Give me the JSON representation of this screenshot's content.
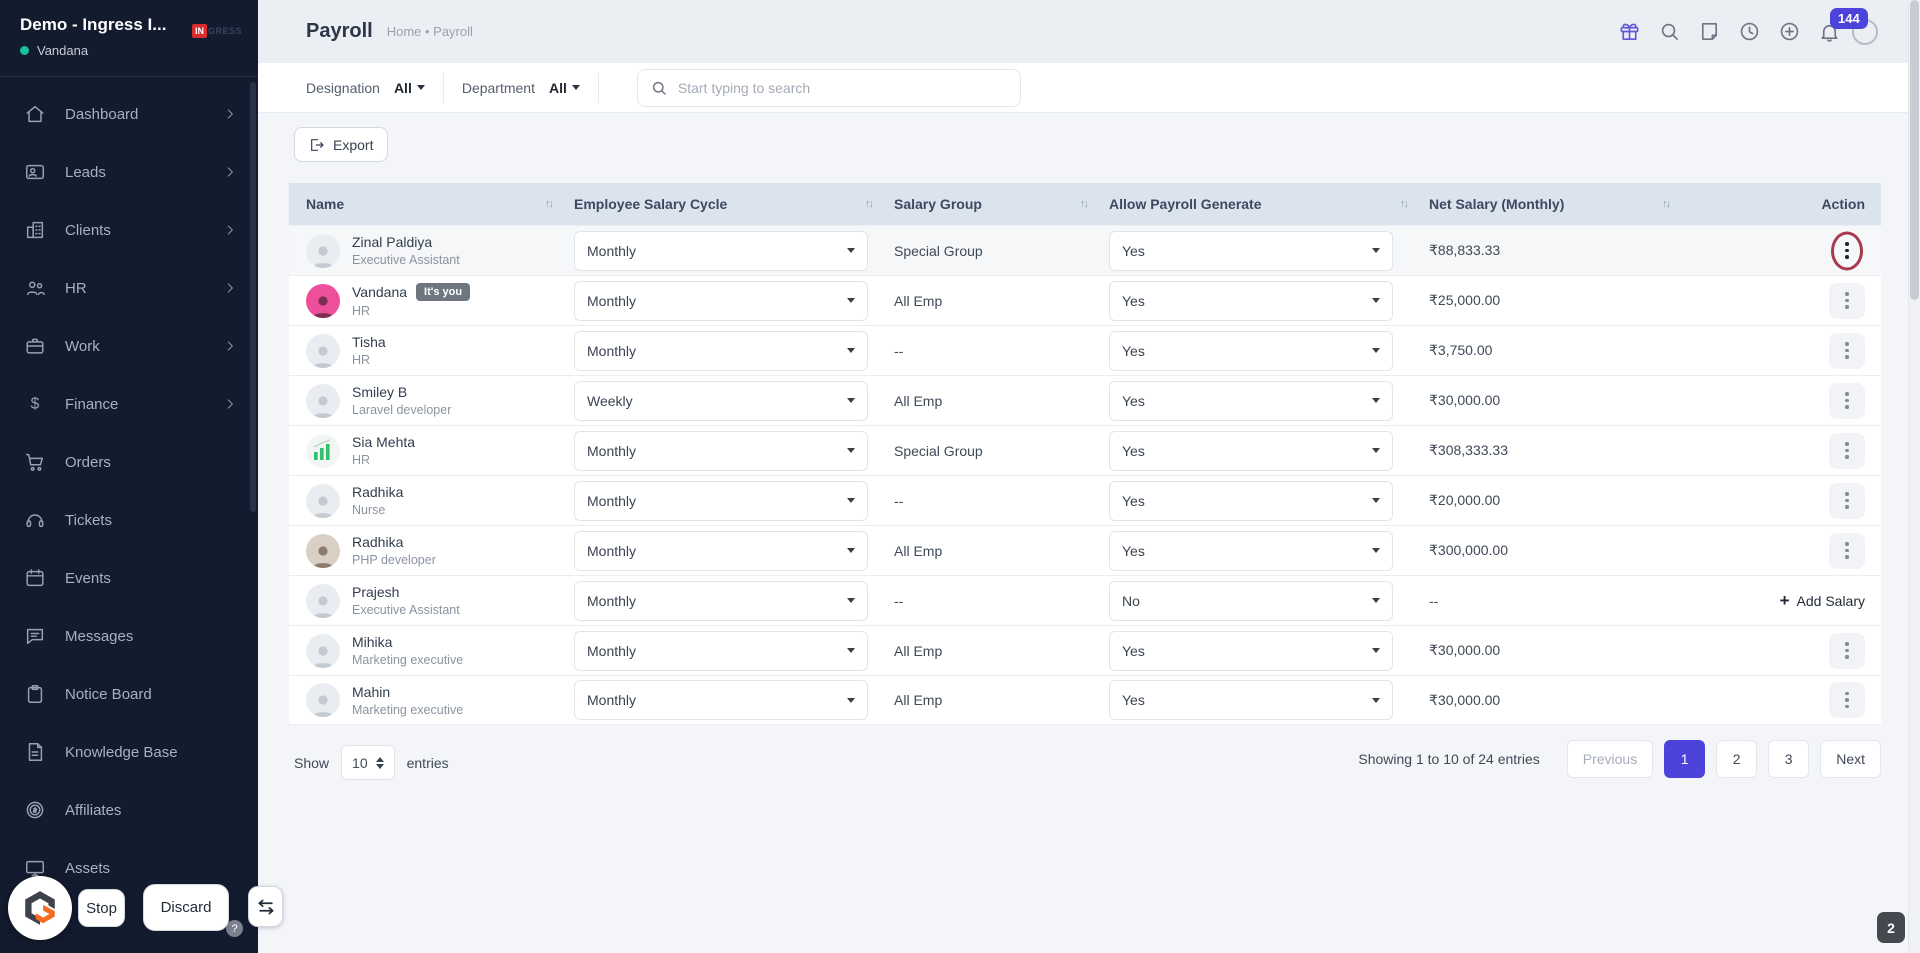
{
  "sidebar": {
    "workspace": "Demo - Ingress I...",
    "user": "Vandana",
    "logo_badge": "IN",
    "logo_rest": "GRESS",
    "items": [
      {
        "label": "Dashboard",
        "icon": "home-icon",
        "chevron": true
      },
      {
        "label": "Leads",
        "icon": "leads-icon",
        "chevron": true
      },
      {
        "label": "Clients",
        "icon": "building-icon",
        "chevron": true
      },
      {
        "label": "HR",
        "icon": "people-icon",
        "chevron": true
      },
      {
        "label": "Work",
        "icon": "briefcase-icon",
        "chevron": true
      },
      {
        "label": "Finance",
        "icon": "dollar-icon",
        "chevron": true
      },
      {
        "label": "Orders",
        "icon": "cart-icon",
        "chevron": false
      },
      {
        "label": "Tickets",
        "icon": "headset-icon",
        "chevron": false
      },
      {
        "label": "Events",
        "icon": "calendar-icon",
        "chevron": false
      },
      {
        "label": "Messages",
        "icon": "chat-icon",
        "chevron": false
      },
      {
        "label": "Notice Board",
        "icon": "clipboard-icon",
        "chevron": false
      },
      {
        "label": "Knowledge Base",
        "icon": "document-icon",
        "chevron": false
      },
      {
        "label": "Affiliates",
        "icon": "coin-icon",
        "chevron": false
      },
      {
        "label": "Assets",
        "icon": "monitor-icon",
        "chevron": false
      }
    ]
  },
  "header": {
    "title": "Payroll",
    "breadcrumb": "Home • Payroll",
    "notification_count": "144",
    "icons": [
      "gift-icon",
      "search-icon",
      "note-icon",
      "clock-icon",
      "plus-circle-icon",
      "bell-icon"
    ]
  },
  "filters": {
    "designation_label": "Designation",
    "designation_value": "All",
    "department_label": "Department",
    "department_value": "All",
    "search_placeholder": "Start typing to search"
  },
  "toolbar": {
    "export_label": "Export"
  },
  "table": {
    "columns": [
      "Name",
      "Employee Salary Cycle",
      "Salary Group",
      "Allow Payroll Generate",
      "Net Salary (Monthly)",
      "Action"
    ],
    "rows": [
      {
        "name": "Zinal Paldiya",
        "role": "Executive Assistant",
        "avatar": "placeholder",
        "badge": "",
        "cycle": "Monthly",
        "group": "Special Group",
        "allow": "Yes",
        "salary": "₹88,833.33",
        "action": "menu",
        "highlight": true,
        "annotated": true
      },
      {
        "name": "Vandana",
        "role": "HR",
        "avatar": "vandana",
        "badge": "It's you",
        "cycle": "Monthly",
        "group": "All Emp",
        "allow": "Yes",
        "salary": "₹25,000.00",
        "action": "menu",
        "highlight": false,
        "annotated": false
      },
      {
        "name": "Tisha",
        "role": "HR",
        "avatar": "placeholder",
        "badge": "",
        "cycle": "Monthly",
        "group": "--",
        "allow": "Yes",
        "salary": "₹3,750.00",
        "action": "menu",
        "highlight": false,
        "annotated": false
      },
      {
        "name": "Smiley B",
        "role": "Laravel developer",
        "avatar": "placeholder",
        "badge": "",
        "cycle": "Weekly",
        "group": "All Emp",
        "allow": "Yes",
        "salary": "₹30,000.00",
        "action": "menu",
        "highlight": false,
        "annotated": false
      },
      {
        "name": "Sia Mehta",
        "role": "HR",
        "avatar": "chart",
        "badge": "",
        "cycle": "Monthly",
        "group": "Special Group",
        "allow": "Yes",
        "salary": "₹308,333.33",
        "action": "menu",
        "highlight": false,
        "annotated": false
      },
      {
        "name": "Radhika",
        "role": "Nurse",
        "avatar": "placeholder",
        "badge": "",
        "cycle": "Monthly",
        "group": "--",
        "allow": "Yes",
        "salary": "₹20,000.00",
        "action": "menu",
        "highlight": false,
        "annotated": false
      },
      {
        "name": "Radhika",
        "role": "PHP developer",
        "avatar": "photo",
        "badge": "",
        "cycle": "Monthly",
        "group": "All Emp",
        "allow": "Yes",
        "salary": "₹300,000.00",
        "action": "menu",
        "highlight": false,
        "annotated": false
      },
      {
        "name": "Prajesh",
        "role": "Executive Assistant",
        "avatar": "placeholder",
        "badge": "",
        "cycle": "Monthly",
        "group": "--",
        "allow": "No",
        "salary": "--",
        "action": "add",
        "add_label": "Add Salary",
        "highlight": false,
        "annotated": false
      },
      {
        "name": "Mihika",
        "role": "Marketing executive",
        "avatar": "placeholder",
        "badge": "",
        "cycle": "Monthly",
        "group": "All Emp",
        "allow": "Yes",
        "salary": "₹30,000.00",
        "action": "menu",
        "highlight": false,
        "annotated": false
      },
      {
        "name": "Mahin",
        "role": "Marketing executive",
        "avatar": "placeholder",
        "badge": "",
        "cycle": "Monthly",
        "group": "All Emp",
        "allow": "Yes",
        "salary": "₹30,000.00",
        "action": "menu",
        "highlight": false,
        "annotated": false
      }
    ]
  },
  "footer": {
    "show_label": "Show",
    "page_size": "10",
    "entries_label": "entries",
    "summary": "Showing 1 to 10 of 24 entries",
    "pagination": {
      "previous": "Previous",
      "pages": [
        "1",
        "2",
        "3"
      ],
      "active": "1",
      "next": "Next"
    }
  },
  "overlay": {
    "stop_label": "Stop",
    "discard_label": "Discard",
    "help_label": "?",
    "corner_badge": "2"
  },
  "colors": {
    "accent": "#4c43db",
    "annotation_ring": "#a83a4e",
    "sidebar_bg": "#131b2e",
    "table_header_bg": "#dbe3ed",
    "online_dot": "#17c29c",
    "logo_red": "#d92b2b"
  }
}
